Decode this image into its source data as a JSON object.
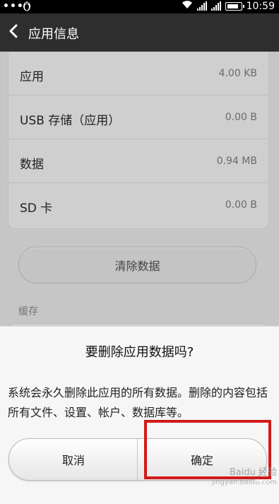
{
  "status_bar": {
    "left_dots": "•••",
    "left_icon": "penguin-icon",
    "time": "10:59",
    "icons": [
      "wifi-icon",
      "signal-icon",
      "signal-icon",
      "battery-icon"
    ]
  },
  "action_bar": {
    "back_icon": "chevron-left-icon",
    "title": "应用信息"
  },
  "storage_rows": [
    {
      "label": "应用",
      "value": "4.00 KB"
    },
    {
      "label": "USB 存储（应用）",
      "value": "0.00 B"
    },
    {
      "label": "数据",
      "value": "0.94 MB"
    },
    {
      "label": "SD 卡",
      "value": "0.00 B"
    }
  ],
  "clear_data_button": "清除数据",
  "cache_label": "缓存",
  "dialog": {
    "title": "要删除应用数据吗?",
    "message": "系统会永久删除此应用的所有数据。删除的内容包括所有文件、设置、帐户、数据库等。",
    "cancel_label": "取消",
    "ok_label": "确定"
  },
  "watermark": {
    "brand": "Baidu 经验",
    "url": "jingyan.baidu.com"
  },
  "colors": {
    "highlight_border": "#d11a1a",
    "action_bar_bg": "#2e2e2e",
    "status_bar_bg": "#000000"
  }
}
